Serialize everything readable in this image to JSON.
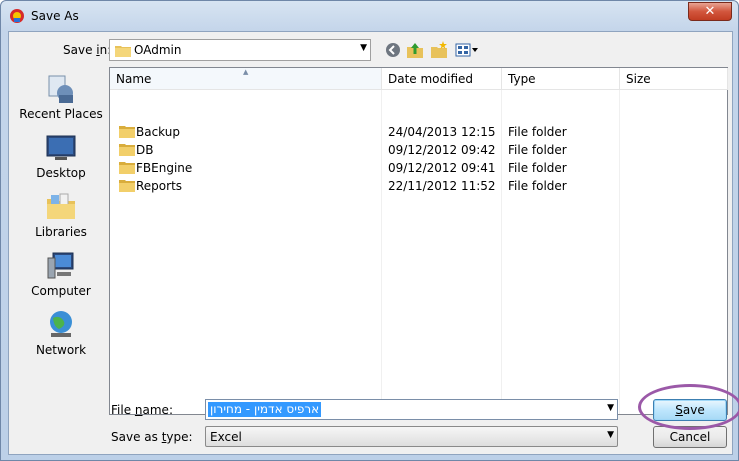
{
  "window": {
    "title": "Save As",
    "close_glyph": "✕"
  },
  "toolbar": {
    "save_in_label_pre": "Save ",
    "save_in_label_key": "i",
    "save_in_label_post": "n:",
    "save_in_value": "OAdmin",
    "nav_icons": [
      "back-icon",
      "up-folder-icon",
      "new-folder-icon",
      "view-menu-icon"
    ]
  },
  "places": [
    {
      "label": "Recent Places",
      "icon": "recent-places-icon"
    },
    {
      "label": "Desktop",
      "icon": "desktop-icon"
    },
    {
      "label": "Libraries",
      "icon": "libraries-icon"
    },
    {
      "label": "Computer",
      "icon": "computer-icon"
    },
    {
      "label": "Network",
      "icon": "network-icon"
    }
  ],
  "columns": {
    "name": "Name",
    "date": "Date modified",
    "type": "Type",
    "size": "Size"
  },
  "files": [
    {
      "name": "Backup",
      "date": "24/04/2013 12:15",
      "type": "File folder"
    },
    {
      "name": "DB",
      "date": "09/12/2012 09:42",
      "type": "File folder"
    },
    {
      "name": "FBEngine",
      "date": "09/12/2012 09:41",
      "type": "File folder"
    },
    {
      "name": "Reports",
      "date": "22/11/2012 11:52",
      "type": "File folder"
    }
  ],
  "form": {
    "file_name_label_pre": "File ",
    "file_name_label_key": "n",
    "file_name_label_post": "ame:",
    "file_name_value": "ארפיס אדמין - מחירון",
    "save_type_label_pre": "Save as ",
    "save_type_label_key": "t",
    "save_type_label_post": "ype:",
    "save_type_value": "Excel"
  },
  "buttons": {
    "save_key": "S",
    "save_rest": "ave",
    "cancel": "Cancel"
  },
  "colors": {
    "selection": "#3399ff",
    "annotation_ring": "#9b59a8"
  }
}
